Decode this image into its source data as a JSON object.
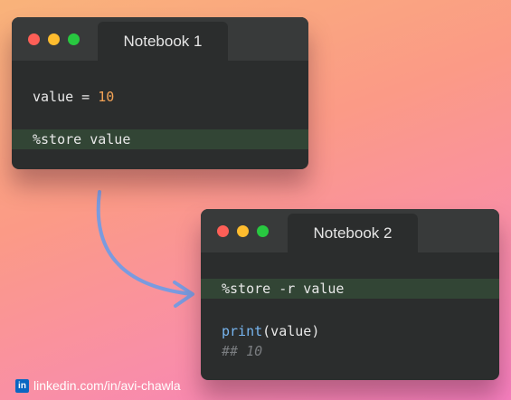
{
  "notebook1": {
    "title": "Notebook 1",
    "lines": [
      {
        "var": "value",
        "op": " = ",
        "num": "10"
      },
      {
        "text": "%store value"
      }
    ]
  },
  "notebook2": {
    "title": "Notebook 2",
    "lines": [
      {
        "text": "%store -r value"
      },
      {
        "fn": "print",
        "args": "(value)"
      },
      {
        "comment": "## 10"
      }
    ]
  },
  "footer": {
    "icon": "linkedin-icon",
    "text": "linkedin.com/in/avi-chawla",
    "badge": "in"
  },
  "colors": {
    "highlight": "#324535",
    "number": "#f3a356",
    "function": "#77b5ef",
    "arrow": "#7a9bdf"
  }
}
